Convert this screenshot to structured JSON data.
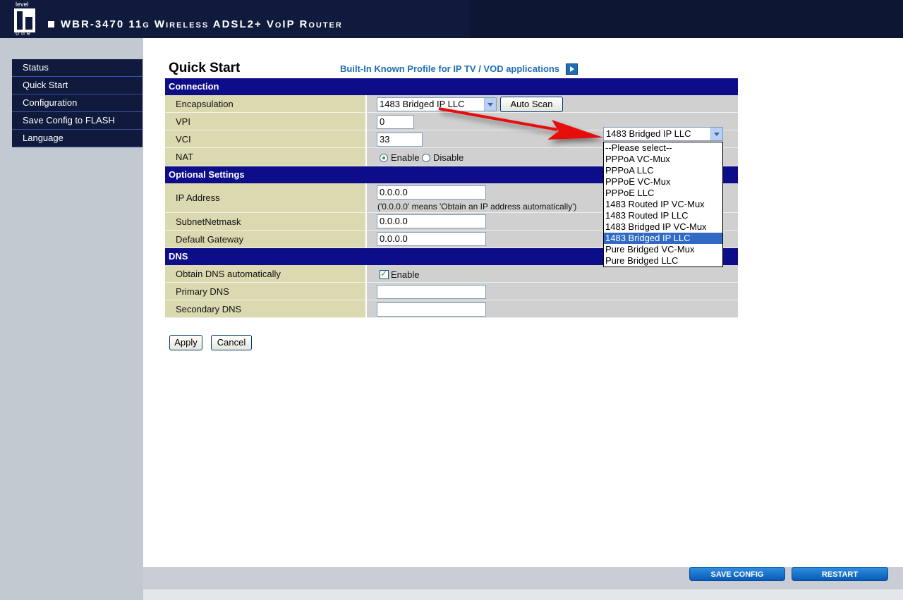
{
  "header": {
    "logo_top": "level",
    "logo_bottom": "one",
    "title": "WBR-3470 11g Wireless ADSL2+ VoIP Router"
  },
  "menu": [
    "Status",
    "Quick Start",
    "Configuration",
    "Save Config to FLASH",
    "Language"
  ],
  "page": {
    "title": "Quick Start",
    "profile_link": "Built-In Known Profile for IP TV / VOD applications"
  },
  "sections": {
    "connection": "Connection",
    "optional": "Optional Settings",
    "dns": "DNS"
  },
  "connection": {
    "encapsulation_label": "Encapsulation",
    "encapsulation_value": "1483 Bridged IP LLC",
    "auto_scan": "Auto Scan",
    "vpi_label": "VPI",
    "vpi_value": "0",
    "vci_label": "VCI",
    "vci_value": "33",
    "nat_label": "NAT",
    "nat_enable": "Enable",
    "nat_disable": "Disable"
  },
  "optional": {
    "ip_label": "IP Address",
    "ip_value": "0.0.0.0",
    "ip_note": "('0.0.0.0' means 'Obtain an IP address automatically')",
    "mask_label": "SubnetNetmask",
    "mask_value": "0.0.0.0",
    "gateway_label": "Default Gateway",
    "gateway_value": "0.0.0.0"
  },
  "dns": {
    "auto_label": "Obtain DNS automatically",
    "auto_enable": "Enable",
    "primary_label": "Primary DNS",
    "primary_value": "",
    "secondary_label": "Secondary DNS",
    "secondary_value": ""
  },
  "buttons": {
    "apply": "Apply",
    "cancel": "Cancel"
  },
  "dropdown": {
    "selected": "1483 Bridged IP LLC",
    "options": [
      "--Please select--",
      "PPPoA VC-Mux",
      "PPPoA LLC",
      "PPPoE VC-Mux",
      "PPPoE LLC",
      "1483 Routed IP VC-Mux",
      "1483 Routed IP LLC",
      "1483 Bridged IP VC-Mux",
      "1483 Bridged IP LLC",
      "Pure Bridged VC-Mux",
      "Pure Bridged LLC"
    ]
  },
  "footer": {
    "save_config": "SAVE CONFIG",
    "restart": "RESTART"
  },
  "colors": {
    "accent": "#0d0d8a",
    "label_bg": "#dad9b0",
    "link": "#1e6fb3",
    "arrow": "#e81010"
  }
}
